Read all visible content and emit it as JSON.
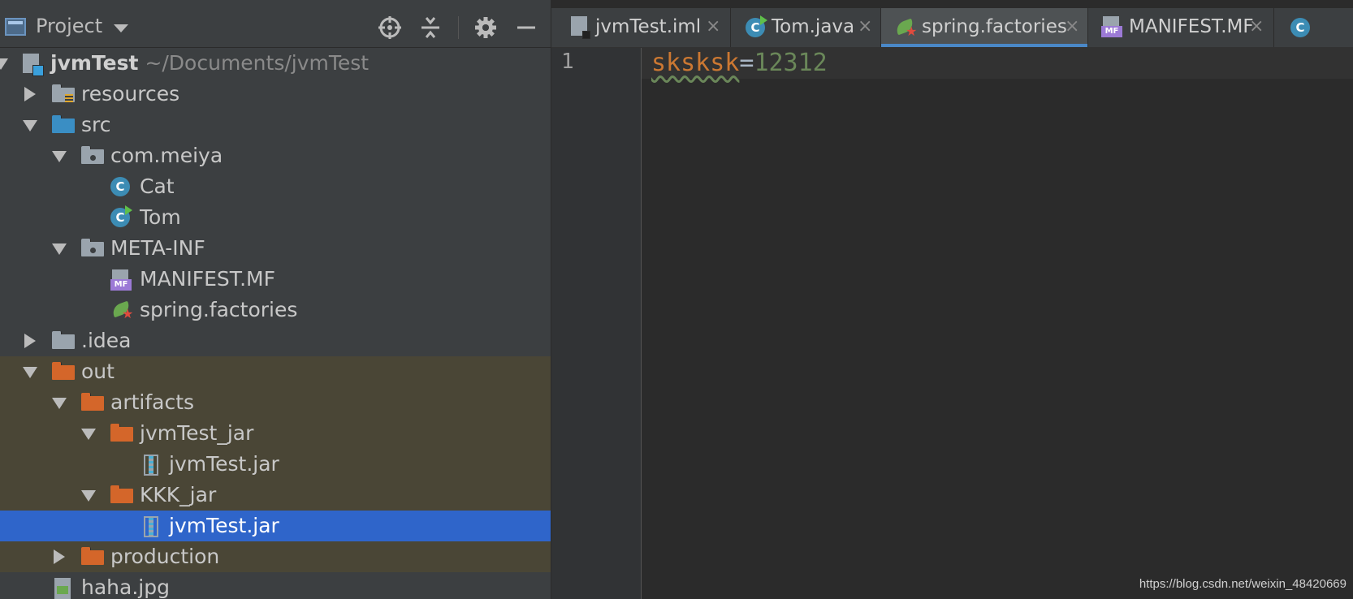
{
  "project_panel": {
    "title": "Project",
    "header_icons": [
      "locate-icon",
      "collapse-all-icon",
      "gear-icon",
      "minimize-icon"
    ],
    "tree": [
      {
        "label": "jvmTest",
        "path": "~/Documents/jvmTest",
        "icon": "module-icon"
      },
      {
        "label": "resources",
        "icon": "resources-folder-icon"
      },
      {
        "label": "src",
        "icon": "source-folder-icon"
      },
      {
        "label": "com.meiya",
        "icon": "package-icon"
      },
      {
        "label": "Cat",
        "icon": "class-icon"
      },
      {
        "label": "Tom",
        "icon": "runnable-class-icon"
      },
      {
        "label": "META-INF",
        "icon": "package-icon"
      },
      {
        "label": "MANIFEST.MF",
        "icon": "manifest-icon"
      },
      {
        "label": "spring.factories",
        "icon": "spring-icon"
      },
      {
        "label": ".idea",
        "icon": "folder-icon"
      },
      {
        "label": "out",
        "icon": "excluded-folder-icon"
      },
      {
        "label": "artifacts",
        "icon": "excluded-folder-icon"
      },
      {
        "label": "jvmTest_jar",
        "icon": "excluded-folder-icon"
      },
      {
        "label": "jvmTest.jar",
        "icon": "jar-icon"
      },
      {
        "label": "KKK_jar",
        "icon": "excluded-folder-icon"
      },
      {
        "label": "jvmTest.jar",
        "icon": "jar-icon",
        "selected": true
      },
      {
        "label": "production",
        "icon": "excluded-folder-icon"
      },
      {
        "label": "haha.jpg",
        "icon": "image-file-icon"
      }
    ]
  },
  "editor": {
    "tabs": [
      {
        "label": "jvmTest.iml",
        "icon": "module-file-icon"
      },
      {
        "label": "Tom.java",
        "icon": "runnable-class-icon"
      },
      {
        "label": "spring.factories",
        "icon": "spring-icon",
        "active": true
      },
      {
        "label": "MANIFEST.MF",
        "icon": "manifest-icon"
      },
      {
        "label": "",
        "icon": "class-icon"
      }
    ],
    "close_glyph": "×",
    "line_number": "1",
    "code": {
      "key": "sksksk",
      "eq": "=",
      "value": "12312"
    }
  },
  "watermark": "https://blog.csdn.net/weixin_48420669",
  "colors": {
    "panel_bg": "#3c3f41",
    "editor_bg": "#2b2b2b",
    "selection": "#2f65ca",
    "excluded_bg": "#4a4636",
    "key": "#cc7832",
    "value": "#6a8759"
  }
}
